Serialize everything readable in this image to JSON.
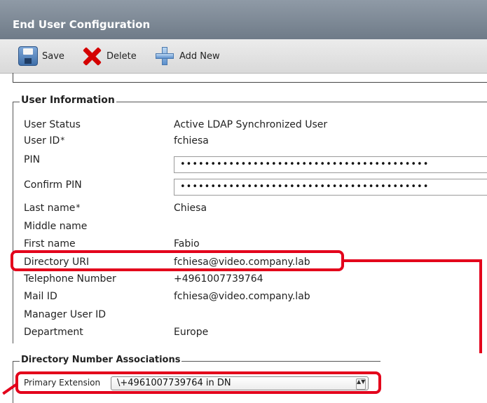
{
  "window": {
    "title": "End User Configuration"
  },
  "toolbar": {
    "save_label": "Save",
    "delete_label": "Delete",
    "add_new_label": "Add New"
  },
  "user_info": {
    "legend": "User Information",
    "required_mark": "*",
    "rows": [
      {
        "label": "User Status",
        "value": "Active LDAP Synchronized User"
      },
      {
        "label": "User ID",
        "value": "fchiesa"
      },
      {
        "label": "PIN",
        "value": "•••••••••••••••••••••••••••••••••••••••••"
      },
      {
        "label": "Confirm PIN",
        "value": "•••••••••••••••••••••••••••••••••••••••••"
      },
      {
        "label": "Last name",
        "value": "Chiesa"
      },
      {
        "label": "Middle name",
        "value": ""
      },
      {
        "label": "First name",
        "value": "Fabio"
      },
      {
        "label": "Directory URI",
        "value": "fchiesa@video.company.lab"
      },
      {
        "label": "Telephone Number",
        "value": "+4961007739764"
      },
      {
        "label": "Mail ID",
        "value": "fchiesa@video.company.lab"
      },
      {
        "label": "Manager User ID",
        "value": ""
      },
      {
        "label": "Department",
        "value": "Europe"
      }
    ]
  },
  "dn_assoc": {
    "legend": "Directory Number Associations",
    "primary_extension_label": "Primary Extension",
    "primary_extension_value": "\\+4961007739764 in DN",
    "arrows": "▲▼"
  },
  "colors": {
    "highlight": "#e3001b",
    "titlebar": "#7b8794",
    "toolbar": "#e2e2e2"
  },
  "icons": [
    "save-icon",
    "delete-icon",
    "add-new-icon"
  ]
}
